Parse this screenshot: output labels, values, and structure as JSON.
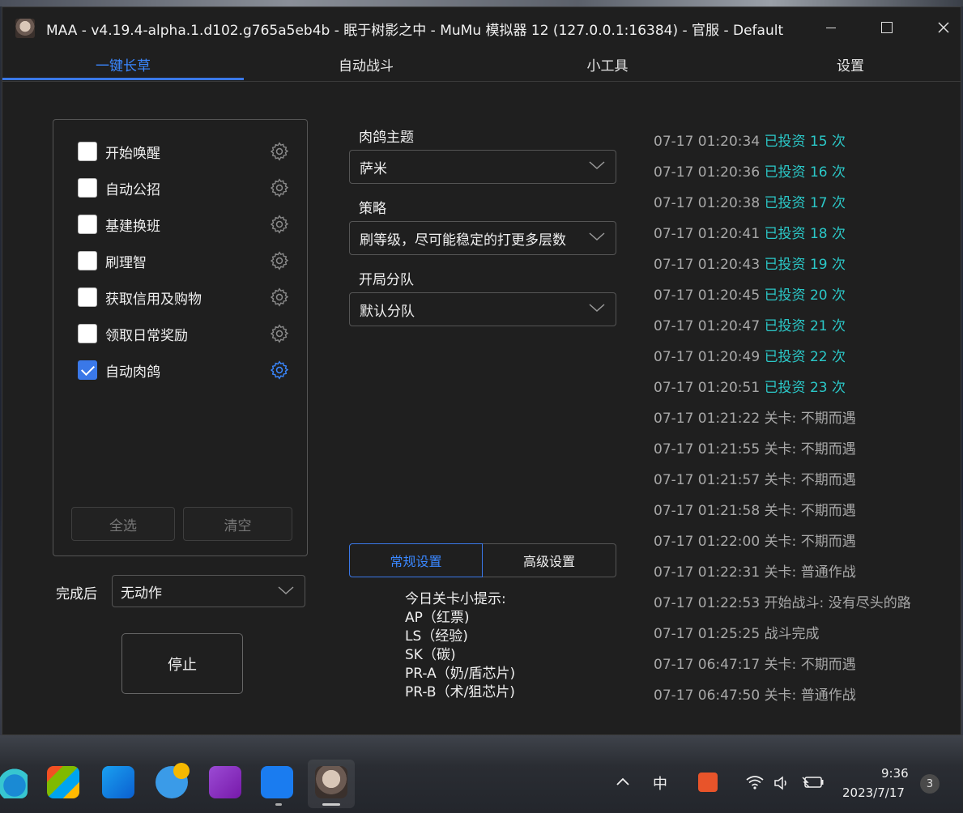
{
  "window": {
    "title": "MAA - v4.19.4-alpha.1.d102.g765a5eb4b - 眠于树影之中 - MuMu 模拟器 12 (127.0.0.1:16384) - 官服 - Default"
  },
  "tabs": [
    {
      "label": "一键长草",
      "active": true
    },
    {
      "label": "自动战斗",
      "active": false
    },
    {
      "label": "小工具",
      "active": false
    },
    {
      "label": "设置",
      "active": false
    }
  ],
  "tasks": [
    {
      "label": "开始唤醒",
      "checked": false
    },
    {
      "label": "自动公招",
      "checked": false
    },
    {
      "label": "基建换班",
      "checked": false
    },
    {
      "label": "刷理智",
      "checked": false
    },
    {
      "label": "获取信用及购物",
      "checked": false
    },
    {
      "label": "领取日常奖励",
      "checked": false
    },
    {
      "label": "自动肉鸽",
      "checked": true
    }
  ],
  "task_buttons": {
    "select_all": "全选",
    "clear": "清空"
  },
  "after_completion": {
    "label": "完成后",
    "value": "无动作"
  },
  "stop_button": "停止",
  "settings": {
    "theme_label": "肉鸽主题",
    "theme_value": "萨米",
    "strategy_label": "策略",
    "strategy_value": "刷等级，尽可能稳定的打更多层数",
    "squad_label": "开局分队",
    "squad_value": "默认分队",
    "tab_general": "常规设置",
    "tab_advanced": "高级设置"
  },
  "hints": {
    "title": "今日关卡小提示:",
    "lines": [
      "AP（红票)",
      "LS（经验)",
      "SK（碳)",
      "PR-A（奶/盾芯片)",
      "PR-B（术/狙芯片)"
    ]
  },
  "log": [
    {
      "date": "07-17",
      "time": "01:20:34",
      "msg": "已投资 15 次",
      "color": "#2bc8c8"
    },
    {
      "date": "07-17",
      "time": "01:20:36",
      "msg": "已投资 16 次",
      "color": "#2bc8c8"
    },
    {
      "date": "07-17",
      "time": "01:20:38",
      "msg": "已投资 17 次",
      "color": "#2bc8c8"
    },
    {
      "date": "07-17",
      "time": "01:20:41",
      "msg": "已投资 18 次",
      "color": "#2bc8c8"
    },
    {
      "date": "07-17",
      "time": "01:20:43",
      "msg": "已投资 19 次",
      "color": "#2bc8c8"
    },
    {
      "date": "07-17",
      "time": "01:20:45",
      "msg": "已投资 20 次",
      "color": "#2bc8c8"
    },
    {
      "date": "07-17",
      "time": "01:20:47",
      "msg": "已投资 21 次",
      "color": "#2bc8c8"
    },
    {
      "date": "07-17",
      "time": "01:20:49",
      "msg": "已投资 22 次",
      "color": "#2bc8c8"
    },
    {
      "date": "07-17",
      "time": "01:20:51",
      "msg": "已投资 23 次",
      "color": "#2bc8c8"
    },
    {
      "date": "07-17",
      "time": "01:21:22",
      "msg": "关卡: 不期而遇",
      "color": "#a8a8a8"
    },
    {
      "date": "07-17",
      "time": "01:21:55",
      "msg": "关卡: 不期而遇",
      "color": "#a8a8a8"
    },
    {
      "date": "07-17",
      "time": "01:21:57",
      "msg": "关卡: 不期而遇",
      "color": "#a8a8a8"
    },
    {
      "date": "07-17",
      "time": "01:21:58",
      "msg": "关卡: 不期而遇",
      "color": "#a8a8a8"
    },
    {
      "date": "07-17",
      "time": "01:22:00",
      "msg": "关卡: 不期而遇",
      "color": "#a8a8a8"
    },
    {
      "date": "07-17",
      "time": "01:22:31",
      "msg": "关卡: 普通作战",
      "color": "#a8a8a8"
    },
    {
      "date": "07-17",
      "time": "01:22:53",
      "msg": "开始战斗: 没有尽头的路",
      "color": "#a8a8a8"
    },
    {
      "date": "07-17",
      "time": "01:25:25",
      "msg": "战斗完成",
      "color": "#a8a8a8"
    },
    {
      "date": "07-17",
      "time": "06:47:17",
      "msg": "关卡: 不期而遇",
      "color": "#a8a8a8"
    },
    {
      "date": "07-17",
      "time": "06:47:50",
      "msg": "关卡: 普通作战",
      "color": "#a8a8a8"
    }
  ],
  "taskbar": {
    "icons": [
      "edge-icon",
      "store-icon",
      "azure-icon",
      "tips-icon",
      "onenote-icon",
      "mumu-icon",
      "maa-icon"
    ],
    "tray_ime": "中",
    "clock_time": "9:36",
    "clock_date": "2023/7/17",
    "notifications": "3"
  },
  "colors": {
    "accent": "#3a78e8",
    "log_highlight": "#2bc8c8",
    "background": "#1f1f1f"
  }
}
